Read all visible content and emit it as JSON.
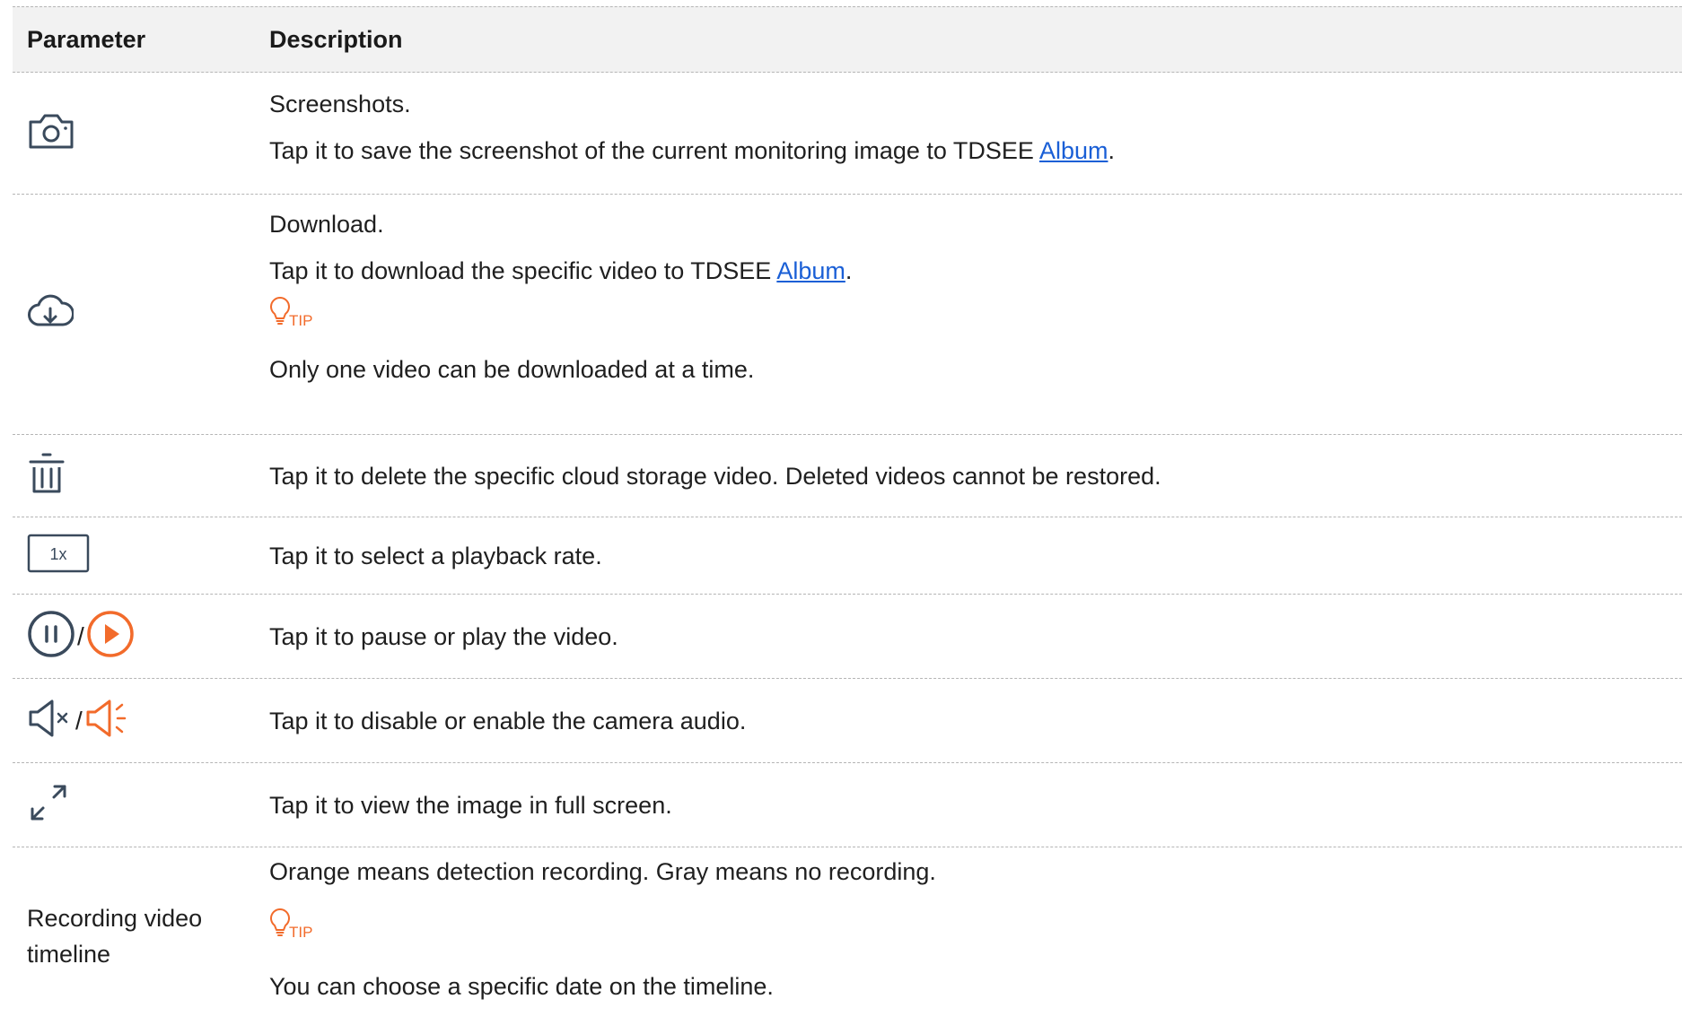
{
  "header": {
    "parameter": "Parameter",
    "description": "Description"
  },
  "rows": {
    "screenshot": {
      "icon": "camera-icon",
      "line1": "Screenshots.",
      "line2_prefix": "Tap it to save the screenshot of the current monitoring image to TDSEE ",
      "line2_link": "Album",
      "line2_suffix": "."
    },
    "download": {
      "icon": "cloud-download-icon",
      "line1": "Download.",
      "line2_prefix": "Tap it to download the specific video to TDSEE ",
      "line2_link": "Album",
      "line2_suffix": ".",
      "tip_label": "TIP",
      "line3": "Only one video can be downloaded at a time."
    },
    "delete": {
      "icon": "trash-icon",
      "line1": "Tap it to delete the specific cloud storage video. Deleted videos cannot be restored."
    },
    "rate": {
      "icon": "playback-rate-icon",
      "icon_text": "1x",
      "line1": "Tap it to select a playback rate."
    },
    "pause_play": {
      "icon_a": "pause-icon",
      "icon_b": "play-icon",
      "separator": "/",
      "line1": "Tap it to pause or play the video."
    },
    "audio": {
      "icon_a": "speaker-muted-icon",
      "icon_b": "speaker-on-icon",
      "separator": "/",
      "line1": "Tap it to disable or enable the camera audio."
    },
    "fullscreen": {
      "icon": "fullscreen-icon",
      "line1": "Tap it to view the image in full screen."
    },
    "timeline": {
      "parameter": "Recording video timeline",
      "line1": "Orange means detection recording. Gray means no recording.",
      "tip_label": "TIP",
      "line3": "You can choose a specific date on the timeline."
    }
  },
  "colors": {
    "accent_orange": "#f26b2b",
    "icon_dark": "#3a4a5c",
    "link_blue": "#1a5fd6",
    "header_bg": "#f2f2f2"
  }
}
